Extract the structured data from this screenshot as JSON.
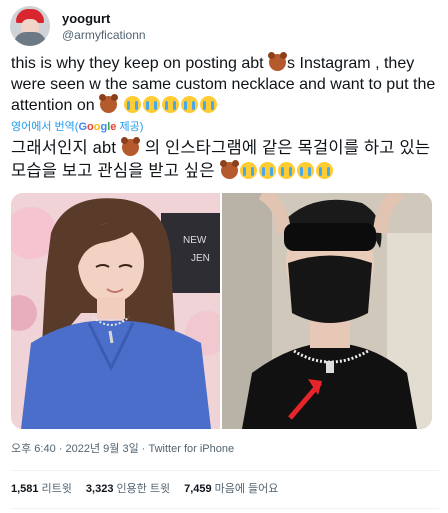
{
  "author": {
    "display_name": "yoogurt",
    "handle": "@armyficationn"
  },
  "tweet": {
    "text_1": "this is why they keep on posting abt",
    "text_2": "s Instagram , they were seen w the same custom necklace and want to put the attention on",
    "emoji_bear": "bear-face",
    "emoji_cry": "loudly-crying-face"
  },
  "translation": {
    "label_pre": "영어에서 번역(",
    "google_word": [
      "G",
      "o",
      "o",
      "g",
      "l",
      "e"
    ],
    "label_post": " 제공)",
    "text_1": "그래서인지 abt",
    "text_2": "의 인스타그램에 같은 목걸이를 하고 있는 모습을 보고 관심을 받고 싶은"
  },
  "meta": {
    "time": "오후 6:40",
    "dot": "·",
    "date": "2022년 9월 3일",
    "source": "Twitter for iPhone"
  },
  "stats": {
    "retweets_count": "1,581",
    "retweets_label": "리트윗",
    "quotes_count": "3,323",
    "quotes_label": "인용한 트윗",
    "likes_count": "7,459",
    "likes_label": "마음에 들어요"
  },
  "photo_text": {
    "sign_top": "NEW",
    "sign_bottom": "JEN"
  },
  "colors": {
    "link": "#1d9bf0",
    "muted": "#536471",
    "arrow": "#e8242b"
  }
}
